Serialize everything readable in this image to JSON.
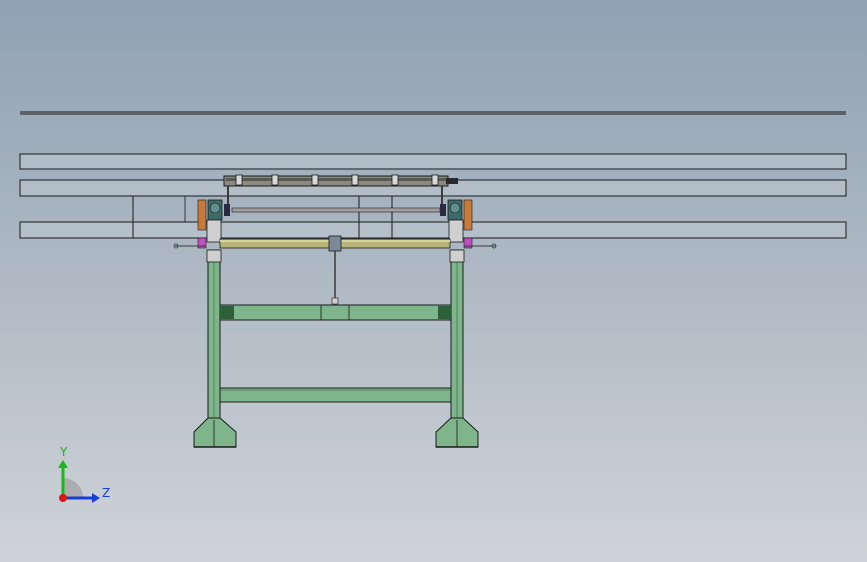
{
  "viewport": {
    "background_top": "#8fa1b3",
    "background_bottom": "#cfd3d8"
  },
  "model": {
    "frame_color": "#7fb58a",
    "frame_dark": "#2f5f38",
    "roller_color": "#b9b47a",
    "rail_color": "#c3ccd4",
    "motor_color": "#3f6a6a",
    "accent_orange": "#c87a3a",
    "accent_magenta": "#c050c0"
  },
  "triad": {
    "y_label": "Y",
    "z_label": "Z",
    "y_color": "#18b818",
    "z_color": "#1840d8",
    "x_color": "#d81818"
  }
}
